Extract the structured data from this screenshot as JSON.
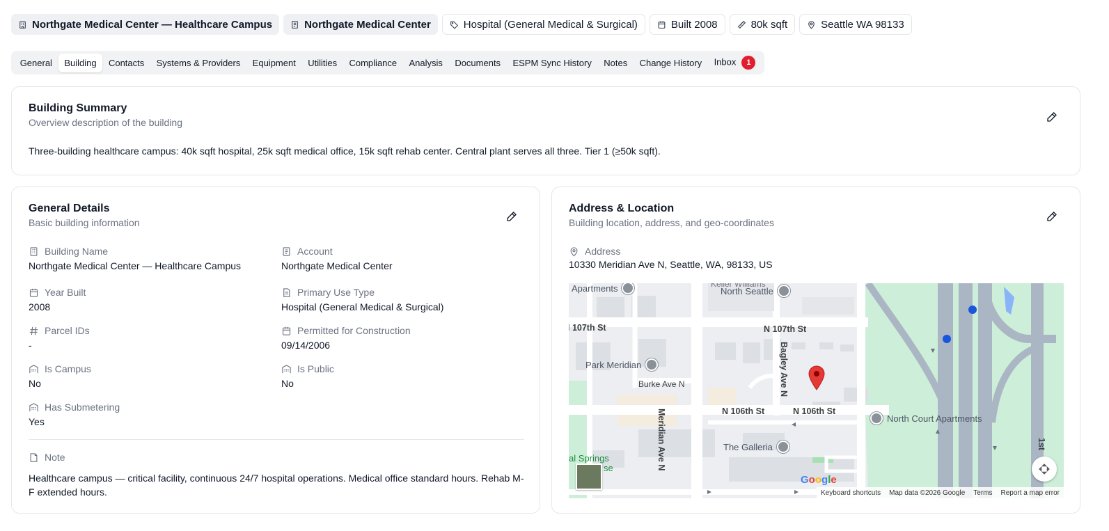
{
  "header": {
    "chips": [
      {
        "label": "Northgate Medical Center — Healthcare Campus",
        "icon": "building-icon"
      },
      {
        "label": "Northgate Medical Center",
        "icon": "document-icon"
      },
      {
        "label": "Hospital (General Medical & Surgical)",
        "icon": "tag-icon"
      },
      {
        "label": "Built 2008",
        "icon": "calendar-icon"
      },
      {
        "label": "80k sqft",
        "icon": "ruler-icon"
      },
      {
        "label": "Seattle WA 98133",
        "icon": "map-pin-icon"
      }
    ]
  },
  "tabs": [
    {
      "label": "General"
    },
    {
      "label": "Building",
      "active": true
    },
    {
      "label": "Contacts"
    },
    {
      "label": "Systems & Providers"
    },
    {
      "label": "Equipment"
    },
    {
      "label": "Utilities"
    },
    {
      "label": "Compliance"
    },
    {
      "label": "Analysis"
    },
    {
      "label": "Documents"
    },
    {
      "label": "ESPM Sync History"
    },
    {
      "label": "Notes"
    },
    {
      "label": "Change History"
    },
    {
      "label": "Inbox",
      "badge": "1"
    }
  ],
  "summary": {
    "title": "Building Summary",
    "subtitle": "Overview description of the building",
    "text": "Three-building healthcare campus: 40k sqft hospital, 25k sqft medical office, 15k sqft rehab center. Central plant serves all three. Tier 1 (≥50k sqft)."
  },
  "general": {
    "title": "General Details",
    "subtitle": "Basic building information",
    "fields": {
      "building_name": {
        "label": "Building Name",
        "value": "Northgate Medical Center — Healthcare Campus"
      },
      "account": {
        "label": "Account",
        "value": "Northgate Medical Center"
      },
      "year_built": {
        "label": "Year Built",
        "value": "2008"
      },
      "primary_use": {
        "label": "Primary Use Type",
        "value": "Hospital (General Medical & Surgical)"
      },
      "parcel_ids": {
        "label": "Parcel IDs",
        "value": "-"
      },
      "permitted": {
        "label": "Permitted for Construction",
        "value": "09/14/2006"
      },
      "is_campus": {
        "label": "Is Campus",
        "value": "No"
      },
      "is_public": {
        "label": "Is Public",
        "value": "No"
      },
      "submetering": {
        "label": "Has Submetering",
        "value": "Yes"
      }
    },
    "note": {
      "label": "Note",
      "text": "Healthcare campus — critical facility, continuous 24/7 hospital operations. Medical office standard hours. Rehab M-F extended hours."
    }
  },
  "address": {
    "title": "Address & Location",
    "subtitle": "Building location, address, and geo-coordinates",
    "label": "Address",
    "value": "10330 Meridian Ave N, Seattle, WA, 98133, US",
    "map": {
      "streets": {
        "n107_left": "l 107th St",
        "n107_right": "N 107th St",
        "n106_left": "N 106th St",
        "n106_right": "N 106th St",
        "burke": "Burke Ave N",
        "meridian": "Meridian Ave N",
        "bagley": "Bagley Ave N",
        "first": "1st"
      },
      "pois": {
        "apartments": "Apartments",
        "keller": "Keller Williams",
        "north_seattle": "North Seattle",
        "park_meridian": "Park Meridian",
        "north_court": "North Court Apartments",
        "galleria": "The Galleria",
        "springs": "al Springs",
        "springs2": "se"
      },
      "google_letters": [
        "G",
        "o",
        "o",
        "g",
        "l",
        "e"
      ],
      "footer": {
        "shortcuts": "Keyboard shortcuts",
        "mapdata": "Map data ©2026 Google",
        "terms": "Terms",
        "report": "Report a map error"
      },
      "colors": {
        "pin": "#e53935",
        "park": "#cdeed8",
        "highway": "#aab6c4",
        "road": "#ffffff"
      }
    }
  }
}
